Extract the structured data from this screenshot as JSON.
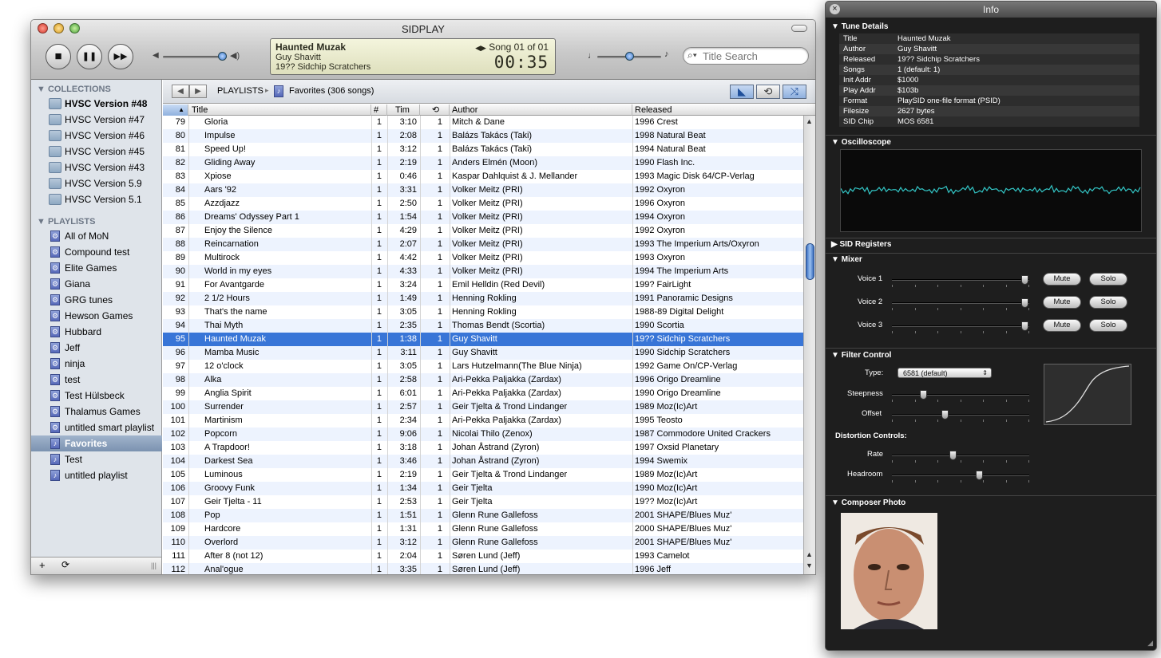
{
  "window": {
    "title": "SIDPLAY"
  },
  "transport": {
    "stop": "■",
    "pause": "❚❚",
    "next": "▶▶"
  },
  "lcd": {
    "title": "Haunted Muzak",
    "author": "Guy Shavitt",
    "released": "19?? Sidchip Scratchers",
    "song": "Song 01 of 01",
    "time": "00:35",
    "song_arrows": "◀▶"
  },
  "search": {
    "placeholder": "Title Search"
  },
  "sidebar": {
    "collections_header": "COLLECTIONS",
    "collections": [
      "HVSC Version #48",
      "HVSC Version #47",
      "HVSC Version #46",
      "HVSC Version #45",
      "HVSC Version #43",
      "HVSC Version 5.9",
      "HVSC Version 5.1"
    ],
    "playlists_header": "PLAYLISTS",
    "playlists": [
      "All of MoN",
      "Compound test",
      "Elite Games",
      "Giana",
      "GRG tunes",
      "Hewson Games",
      "Hubbard",
      "Jeff",
      "ninja",
      "test",
      "Test Hülsbeck",
      "Thalamus Games",
      "untitled smart playlist",
      "Favorites",
      "Test",
      "untitled playlist"
    ],
    "selected_playlist": "Favorites",
    "footer": {
      "add": "+",
      "refresh": "⟳",
      "grip": "|||"
    }
  },
  "breadcrumb": {
    "root": "PLAYLISTS",
    "separator": "▸",
    "current": "Favorites (306 songs)"
  },
  "table": {
    "columns": {
      "title": "Title",
      "number": "#",
      "time": "Tim",
      "songs": "⟲",
      "author": "Author",
      "released": "Released"
    },
    "selected_no": "95",
    "rows": [
      {
        "no": "79",
        "title": "Gloria",
        "n": "1",
        "time": "3:10",
        "songs": "1",
        "author": "Mitch & Dane",
        "released": "1996 Crest"
      },
      {
        "no": "80",
        "title": "Impulse",
        "n": "1",
        "time": "2:08",
        "songs": "1",
        "author": "Balázs Takács (Taki)",
        "released": "1998 Natural Beat"
      },
      {
        "no": "81",
        "title": "Speed Up!",
        "n": "1",
        "time": "3:12",
        "songs": "1",
        "author": "Balázs Takács (Taki)",
        "released": "1994 Natural Beat"
      },
      {
        "no": "82",
        "title": "Gliding Away",
        "n": "1",
        "time": "2:19",
        "songs": "1",
        "author": "Anders Elmén (Moon)",
        "released": "1990 Flash Inc."
      },
      {
        "no": "83",
        "title": "Xpiose",
        "n": "1",
        "time": "0:46",
        "songs": "1",
        "author": "Kaspar Dahlquist & J. Mellander",
        "released": "1993 Magic Disk 64/CP-Verlag"
      },
      {
        "no": "84",
        "title": "Aars '92",
        "n": "1",
        "time": "3:31",
        "songs": "1",
        "author": "Volker Meitz (PRI)",
        "released": "1992 Oxyron"
      },
      {
        "no": "85",
        "title": "Azzdjazz",
        "n": "1",
        "time": "2:50",
        "songs": "1",
        "author": "Volker Meitz (PRI)",
        "released": "1996 Oxyron"
      },
      {
        "no": "86",
        "title": "Dreams' Odyssey Part 1",
        "n": "1",
        "time": "1:54",
        "songs": "1",
        "author": "Volker Meitz (PRI)",
        "released": "1994 Oxyron"
      },
      {
        "no": "87",
        "title": "Enjoy the Silence",
        "n": "1",
        "time": "4:29",
        "songs": "1",
        "author": "Volker Meitz (PRI)",
        "released": "1992 Oxyron"
      },
      {
        "no": "88",
        "title": "Reincarnation",
        "n": "1",
        "time": "2:07",
        "songs": "1",
        "author": "Volker Meitz (PRI)",
        "released": "1993 The Imperium Arts/Oxyron"
      },
      {
        "no": "89",
        "title": "Multirock",
        "n": "1",
        "time": "4:42",
        "songs": "1",
        "author": "Volker Meitz (PRI)",
        "released": "1993 Oxyron"
      },
      {
        "no": "90",
        "title": "World in my eyes",
        "n": "1",
        "time": "4:33",
        "songs": "1",
        "author": "Volker Meitz (PRI)",
        "released": "1994 The Imperium Arts"
      },
      {
        "no": "91",
        "title": "For Avantgarde",
        "n": "1",
        "time": "3:24",
        "songs": "1",
        "author": "Emil Helldin (Red Devil)",
        "released": "199? FairLight"
      },
      {
        "no": "92",
        "title": "2 1/2 Hours",
        "n": "1",
        "time": "1:49",
        "songs": "1",
        "author": "Henning Rokling",
        "released": "1991 Panoramic Designs"
      },
      {
        "no": "93",
        "title": "That's the name",
        "n": "1",
        "time": "3:05",
        "songs": "1",
        "author": "Henning Rokling",
        "released": "1988-89 Digital Delight"
      },
      {
        "no": "94",
        "title": "Thai Myth",
        "n": "1",
        "time": "2:35",
        "songs": "1",
        "author": "Thomas Bendt (Scortia)",
        "released": "1990 Scortia"
      },
      {
        "no": "95",
        "title": "Haunted Muzak",
        "n": "1",
        "time": "1:38",
        "songs": "1",
        "author": "Guy Shavitt",
        "released": "19?? Sidchip Scratchers"
      },
      {
        "no": "96",
        "title": "Mamba Music",
        "n": "1",
        "time": "3:11",
        "songs": "1",
        "author": "Guy Shavitt",
        "released": "1990 Sidchip Scratchers"
      },
      {
        "no": "97",
        "title": "12 o'clock",
        "n": "1",
        "time": "3:05",
        "songs": "1",
        "author": "Lars Hutzelmann(The Blue Ninja)",
        "released": "1992 Game On/CP-Verlag"
      },
      {
        "no": "98",
        "title": "Alka",
        "n": "1",
        "time": "2:58",
        "songs": "1",
        "author": "Ari-Pekka Paljakka (Zardax)",
        "released": "1996 Origo Dreamline"
      },
      {
        "no": "99",
        "title": "Anglia Spirit",
        "n": "1",
        "time": "6:01",
        "songs": "1",
        "author": "Ari-Pekka Paljakka (Zardax)",
        "released": "1990 Origo Dreamline"
      },
      {
        "no": "100",
        "title": "Surrender",
        "n": "1",
        "time": "2:57",
        "songs": "1",
        "author": "Geir Tjelta & Trond Lindanger",
        "released": "1989 Moz(Ic)Art"
      },
      {
        "no": "101",
        "title": "Martinism",
        "n": "1",
        "time": "2:34",
        "songs": "1",
        "author": "Ari-Pekka Paljakka (Zardax)",
        "released": "1995 Teosto"
      },
      {
        "no": "102",
        "title": "Popcorn",
        "n": "1",
        "time": "9:06",
        "songs": "1",
        "author": "Nicolai Thilo (Zenox)",
        "released": "1987 Commodore United Crackers"
      },
      {
        "no": "103",
        "title": "A Trapdoor!",
        "n": "1",
        "time": "3:18",
        "songs": "1",
        "author": "Johan Åstrand (Zyron)",
        "released": "1997 Oxsid Planetary"
      },
      {
        "no": "104",
        "title": "Darkest Sea",
        "n": "1",
        "time": "3:46",
        "songs": "1",
        "author": "Johan Åstrand (Zyron)",
        "released": "1994 Swemix"
      },
      {
        "no": "105",
        "title": "Luminous",
        "n": "1",
        "time": "2:19",
        "songs": "1",
        "author": "Geir Tjelta & Trond Lindanger",
        "released": "1989 Moz(Ic)Art"
      },
      {
        "no": "106",
        "title": "Groovy Funk",
        "n": "1",
        "time": "1:34",
        "songs": "1",
        "author": "Geir Tjelta",
        "released": "1990 Moz(Ic)Art"
      },
      {
        "no": "107",
        "title": "Geir Tjelta - 11",
        "n": "1",
        "time": "2:53",
        "songs": "1",
        "author": "Geir Tjelta",
        "released": "19?? Moz(Ic)Art"
      },
      {
        "no": "108",
        "title": "Pop",
        "n": "1",
        "time": "1:51",
        "songs": "1",
        "author": "Glenn Rune Gallefoss",
        "released": "2001 SHAPE/Blues Muz'"
      },
      {
        "no": "109",
        "title": "Hardcore",
        "n": "1",
        "time": "1:31",
        "songs": "1",
        "author": "Glenn Rune Gallefoss",
        "released": "2000 SHAPE/Blues Muz'"
      },
      {
        "no": "110",
        "title": "Overlord",
        "n": "1",
        "time": "3:12",
        "songs": "1",
        "author": "Glenn Rune Gallefoss",
        "released": "2001 SHAPE/Blues Muz'"
      },
      {
        "no": "111",
        "title": "After 8 (not 12)",
        "n": "1",
        "time": "2:04",
        "songs": "1",
        "author": "Søren Lund (Jeff)",
        "released": "1993 Camelot"
      },
      {
        "no": "112",
        "title": "Anal'ogue",
        "n": "1",
        "time": "3:35",
        "songs": "1",
        "author": "Søren Lund (Jeff)",
        "released": "1996 Jeff"
      }
    ]
  },
  "info": {
    "title": "Info",
    "tune_details_header": "Tune Details",
    "details": [
      {
        "k": "Title",
        "v": "Haunted Muzak"
      },
      {
        "k": "Author",
        "v": "Guy Shavitt"
      },
      {
        "k": "Released",
        "v": "19?? Sidchip Scratchers"
      },
      {
        "k": "Songs",
        "v": "1 (default: 1)"
      },
      {
        "k": "Init Addr",
        "v": "$1000"
      },
      {
        "k": "Play Addr",
        "v": "$103b"
      },
      {
        "k": "Format",
        "v": "PlaySID one-file format (PSID)"
      },
      {
        "k": "Filesize",
        "v": "2627 bytes"
      },
      {
        "k": "SID Chip",
        "v": "MOS 6581"
      }
    ],
    "oscilloscope_header": "Oscilloscope",
    "osc_color": "#33c6c6",
    "sid_registers_header": "SID Registers",
    "mixer_header": "Mixer",
    "voices": [
      {
        "label": "Voice 1",
        "mute": "Mute",
        "solo": "Solo",
        "level": 0.97
      },
      {
        "label": "Voice 2",
        "mute": "Mute",
        "solo": "Solo",
        "level": 0.97
      },
      {
        "label": "Voice 3",
        "mute": "Mute",
        "solo": "Solo",
        "level": 0.97
      }
    ],
    "filter_header": "Filter Control",
    "type_label": "Type:",
    "type_value": "6581 (default)",
    "steepness_label": "Steepness",
    "steepness": 0.23,
    "offset_label": "Offset",
    "offset": 0.39,
    "distortion_header": "Distortion Controls:",
    "rate_label": "Rate",
    "rate": 0.45,
    "headroom_label": "Headroom",
    "headroom": 0.64,
    "composer_header": "Composer Photo"
  }
}
